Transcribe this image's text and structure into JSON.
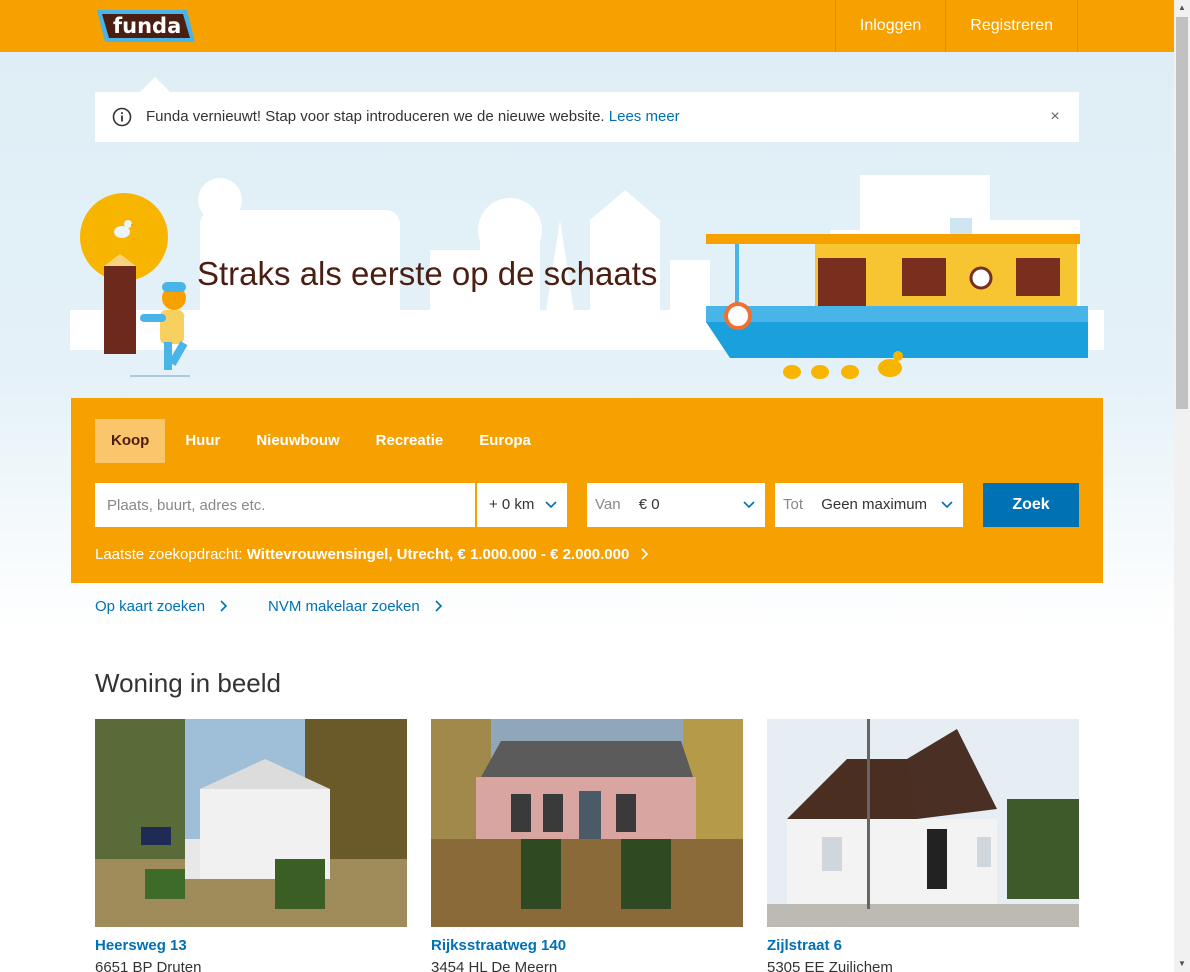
{
  "header": {
    "logo_text": "funda",
    "nav": [
      "Inloggen",
      "Registreren"
    ]
  },
  "notice": {
    "text": "Funda vernieuwt! Stap voor stap introduceren we de nieuwe website.",
    "link": "Lees meer",
    "close_icon": "close-icon",
    "info_icon": "info-icon"
  },
  "hero": {
    "title": "Straks als eerste op de schaats"
  },
  "search": {
    "tabs": [
      "Koop",
      "Huur",
      "Nieuwbouw",
      "Recreatie",
      "Europa"
    ],
    "active_tab": "Koop",
    "location_placeholder": "Plaats, buurt, adres etc.",
    "radius_value": "+ 0 km",
    "price_from_label": "Van",
    "price_from_value": "€ 0",
    "price_to_label": "Tot",
    "price_to_value": "Geen maximum",
    "submit_label": "Zoek",
    "last_search_label": "Laatste zoekopdracht:",
    "last_search_value": "Wittevrouwensingel, Utrecht, € 1.000.000 - € 2.000.000"
  },
  "links": {
    "map_search": "Op kaart zoeken",
    "nvm_search": "NVM makelaar zoeken"
  },
  "featured": {
    "title": "Woning in beeld",
    "cards": [
      {
        "street": "Heersweg 13",
        "city": "6651 BP Druten"
      },
      {
        "street": "Rijksstraatweg 140",
        "city": "3454 HL De Meern"
      },
      {
        "street": "Zijlstraat 6",
        "city": "5305 EE Zuilichem"
      }
    ]
  },
  "colors": {
    "brand_orange": "#f7a100",
    "link_blue": "#0071b3",
    "hero_text": "#4a1e12"
  }
}
